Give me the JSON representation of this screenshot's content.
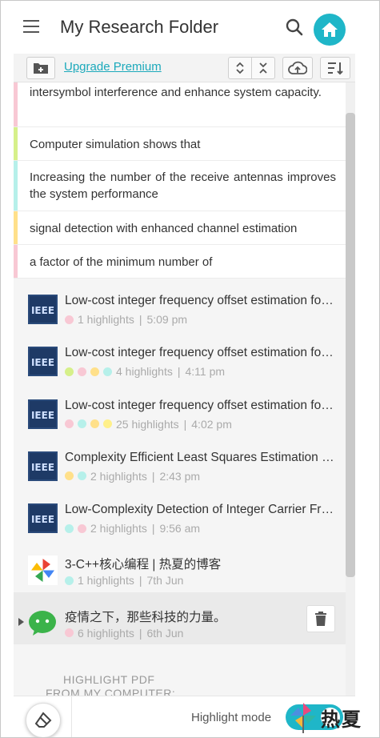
{
  "header": {
    "title": "My Research Folder",
    "menu_icon": "hamburger-menu-icon",
    "search_icon": "search-icon",
    "home_icon": "home-icon"
  },
  "toolbar": {
    "upgrade_label": "Upgrade Premium",
    "add_folder_icon": "folder-add-icon",
    "expand_icon": "expand-icon",
    "collapse_icon": "collapse-icon",
    "upload_icon": "cloud-upload-icon",
    "sort_icon": "sort-icon"
  },
  "highlights": [
    {
      "text": "intersymbol interference and enhance system capacity.",
      "color": "#f8c8d4"
    },
    {
      "text": "Computer simulation shows that",
      "color": "#d6f08a"
    },
    {
      "text": "Increasing the number of the receive antennas improves the system performance",
      "color": "#b6f0ea"
    },
    {
      "text": "signal detection with enhanced channel estimation",
      "color": "#ffe08a"
    },
    {
      "text": "a factor of the minimum number of",
      "color": "#f8c8d4"
    }
  ],
  "documents": [
    {
      "title": "Low-cost integer frequency offset estimation for OFDM",
      "count": "1 highlights",
      "time": "5:09 pm",
      "dots": [
        "#f8c8d4"
      ],
      "source": "ieee"
    },
    {
      "title": "Low-cost integer frequency offset estimation for OFDM",
      "count": "4 highlights",
      "time": "4:11 pm",
      "dots": [
        "#d6f08a",
        "#f8c8d4",
        "#ffe08a",
        "#b6f0ea"
      ],
      "source": "ieee"
    },
    {
      "title": "Low-cost integer frequency offset estimation for OFDM",
      "count": "25 highlights",
      "time": "4:02 pm",
      "dots": [
        "#f8c8d4",
        "#b6f0ea",
        "#ffe08a",
        "#fff08a"
      ],
      "source": "ieee"
    },
    {
      "title": "Complexity Efficient Least Squares Estimation of Frequency",
      "count": "2 highlights",
      "time": "2:43 pm",
      "dots": [
        "#ffe08a",
        "#b6f0ea"
      ],
      "source": "ieee"
    },
    {
      "title": "Low-Complexity Detection of Integer Carrier Frequency Offset",
      "count": "2 highlights",
      "time": "9:56 am",
      "dots": [
        "#b6f0ea",
        "#f8c8d4"
      ],
      "source": "ieee"
    },
    {
      "title": "3-C++核心编程 | 热夏的博客",
      "count": "1 highlights",
      "time": "7th Jun",
      "dots": [
        "#b6f0ea"
      ],
      "source": "pinwheel"
    },
    {
      "title": "疫情之下，那些科技的力量。",
      "count": "6 highlights",
      "time": "6th Jun",
      "dots": [
        "#f8c8d4"
      ],
      "source": "wechat"
    }
  ],
  "cta": {
    "line1": "HIGHLIGHT PDF",
    "line2": "FROM MY COMPUTER:"
  },
  "footer": {
    "eraser_icon": "eraser-icon",
    "mode_label": "Highlight mode",
    "toggle_on": true
  },
  "watermark": {
    "text": "热夏"
  }
}
